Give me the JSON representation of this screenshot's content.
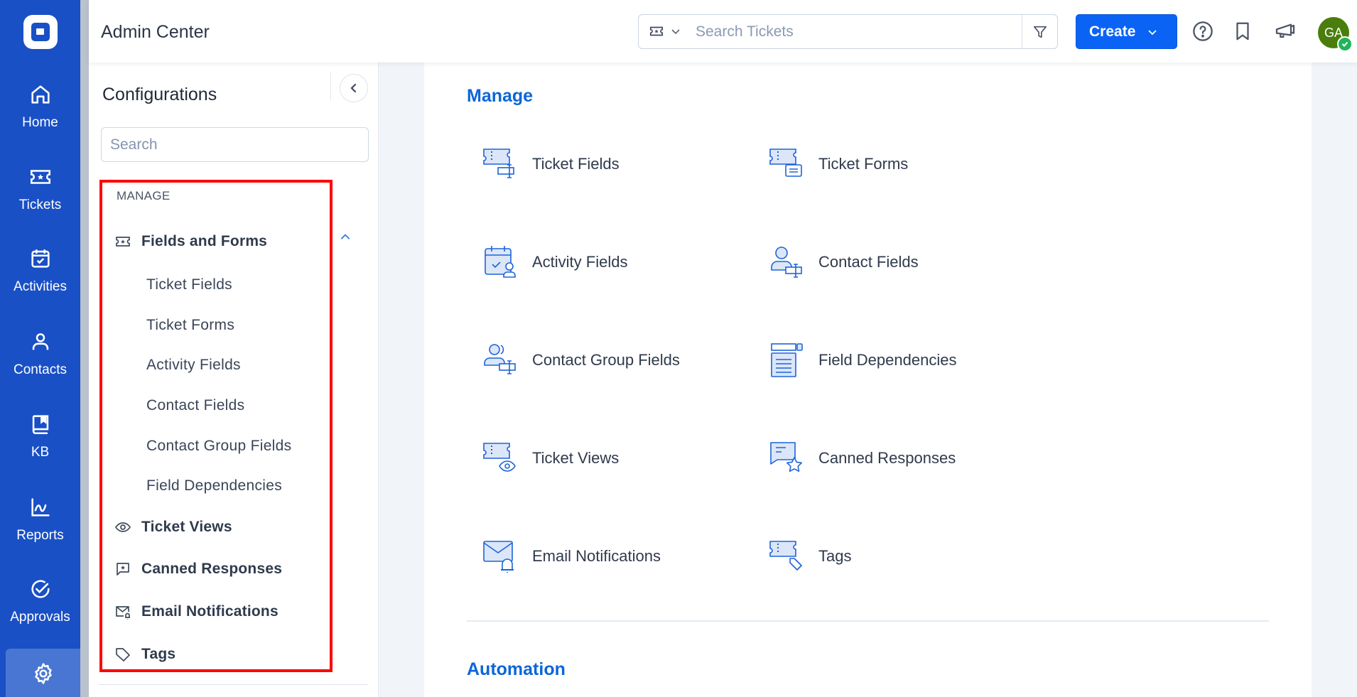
{
  "app": {
    "title": "Admin Center"
  },
  "nav": {
    "items": [
      {
        "id": "home",
        "label": "Home",
        "icon": "home-icon"
      },
      {
        "id": "tickets",
        "label": "Tickets",
        "icon": "ticket-icon"
      },
      {
        "id": "activities",
        "label": "Activities",
        "icon": "calendar-check-icon"
      },
      {
        "id": "contacts",
        "label": "Contacts",
        "icon": "user-icon"
      },
      {
        "id": "kb",
        "label": "KB",
        "icon": "book-icon"
      },
      {
        "id": "reports",
        "label": "Reports",
        "icon": "chart-line-icon"
      },
      {
        "id": "approvals",
        "label": "Approvals",
        "icon": "check-circle-icon"
      },
      {
        "id": "settings",
        "label": "",
        "icon": "gear-icon",
        "active": true
      }
    ]
  },
  "header": {
    "search_placeholder": "Search Tickets",
    "search_type_icon": "ticket-icon",
    "create_label": "Create",
    "avatar_initials": "GA",
    "avatar_color": "#4a7d0c",
    "status_color": "#21b45b",
    "brand_color": "#0b63f6"
  },
  "config": {
    "title": "Configurations",
    "search_placeholder": "Search",
    "section_label": "MANAGE",
    "group": {
      "label": "Fields and Forms",
      "expanded": true,
      "children": [
        "Ticket Fields",
        "Ticket Forms",
        "Activity Fields",
        "Contact Fields",
        "Contact Group Fields",
        "Field Dependencies"
      ]
    },
    "items": [
      {
        "label": "Ticket Views",
        "icon": "eye-icon"
      },
      {
        "label": "Canned Responses",
        "icon": "chat-star-icon"
      },
      {
        "label": "Email Notifications",
        "icon": "mail-bell-icon"
      },
      {
        "label": "Tags",
        "icon": "tag-icon"
      }
    ]
  },
  "main": {
    "sections": [
      {
        "heading": "Manage",
        "tiles": [
          {
            "label": "Ticket Fields",
            "icon": "ticket-field-icon"
          },
          {
            "label": "Ticket Forms",
            "icon": "ticket-form-icon"
          },
          {
            "label": "Activity Fields",
            "icon": "activity-field-icon"
          },
          {
            "label": "Contact Fields",
            "icon": "contact-field-icon"
          },
          {
            "label": "Contact Group Fields",
            "icon": "contact-group-field-icon"
          },
          {
            "label": "Field Dependencies",
            "icon": "field-dependency-icon"
          },
          {
            "label": "Ticket Views",
            "icon": "ticket-view-icon"
          },
          {
            "label": "Canned Responses",
            "icon": "canned-response-icon"
          },
          {
            "label": "Email Notifications",
            "icon": "email-notification-icon"
          },
          {
            "label": "Tags",
            "icon": "tag-ticket-icon"
          }
        ]
      },
      {
        "heading": "Automation",
        "tiles": []
      }
    ]
  }
}
